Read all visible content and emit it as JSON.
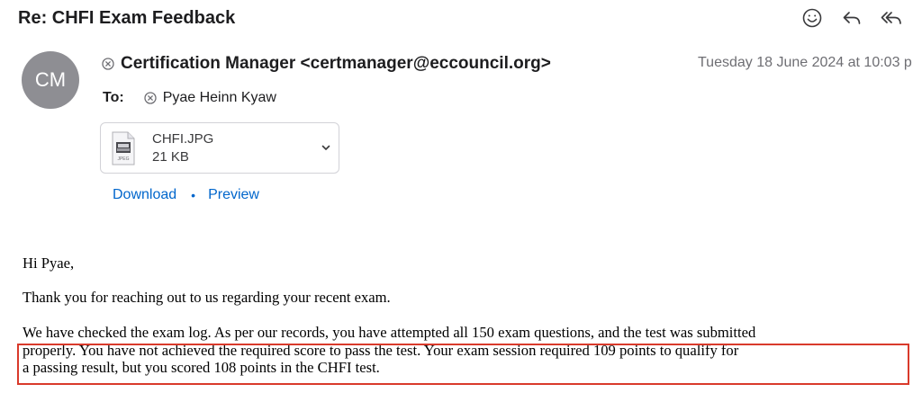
{
  "email": {
    "subject": "Re: CHFI Exam Feedback",
    "toolbar": {
      "icons": [
        "smiley-icon",
        "reply-icon",
        "reply-all-icon"
      ]
    },
    "sender": {
      "initials": "CM",
      "display": "Certification Manager <certmanager@eccouncil.org>",
      "date": "Tuesday 18 June 2024 at 10:03 p"
    },
    "to": {
      "label": "To:",
      "name": "Pyae Heinn Kyaw"
    },
    "attachment": {
      "name": "CHFI.JPG",
      "size": "21 KB",
      "icon_label": "JPEG"
    },
    "actions": {
      "download": "Download",
      "separator": "•",
      "preview": "Preview"
    },
    "body": {
      "greeting": "Hi Pyae,",
      "para1": "Thank you for reaching out to us regarding your recent exam.",
      "para2_line1": "We have checked the exam log. As per our records, you have attempted all 150 exam questions, and the test was submitted",
      "para2_line2": "properly.  You have not achieved the required score to pass the test. Your exam session required 109 points to qualify for",
      "para2_line3": "a passing result, but you scored 108 points in the CHFI test."
    },
    "colors": {
      "link": "#0066cc",
      "avatar_bg": "#8e8e93",
      "highlight_border": "#d93a2b"
    }
  }
}
